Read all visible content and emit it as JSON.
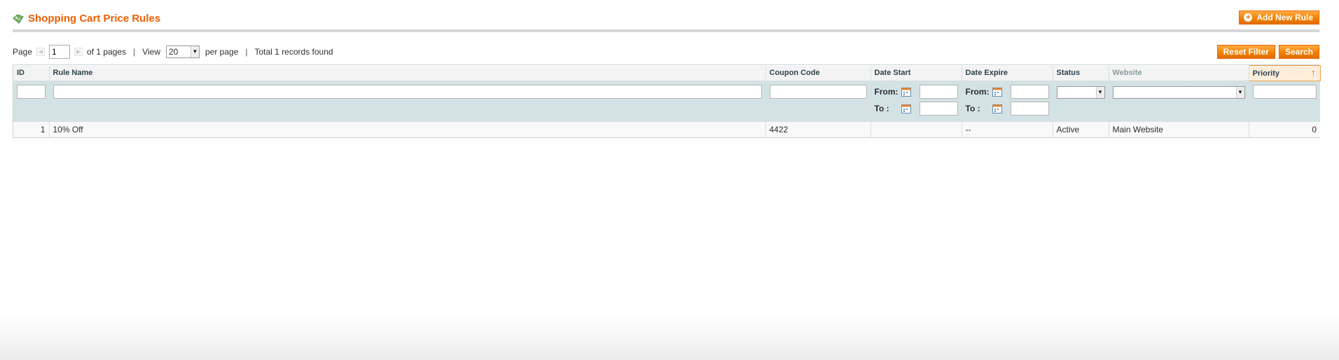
{
  "header": {
    "title": "Shopping Cart Price Rules",
    "add_button_label": "Add New Rule",
    "title_icon": "tag-icon"
  },
  "pager": {
    "page_label": "Page",
    "current_page": "1",
    "of_pages": "of 1 pages",
    "view_label": "View",
    "per_page_value": "20",
    "per_page_label": "per page",
    "total_records": "Total 1 records found"
  },
  "actions": {
    "reset_filter": "Reset Filter",
    "search": "Search"
  },
  "columns": {
    "id": "ID",
    "rule_name": "Rule Name",
    "coupon_code": "Coupon Code",
    "date_start": "Date Start",
    "date_expire": "Date Expire",
    "status": "Status",
    "website": "Website",
    "priority": "Priority"
  },
  "filters": {
    "from_label": "From:",
    "to_label": "To :"
  },
  "rows": [
    {
      "id": "1",
      "rule_name": "10% Off",
      "coupon_code": "4422",
      "date_start": "",
      "date_expire": "--",
      "status": "Active",
      "website": "Main Website",
      "priority": "0"
    }
  ],
  "colors": {
    "accent": "#eb5e00",
    "button": "#f18200",
    "filter_bg": "#d3e2e5"
  }
}
